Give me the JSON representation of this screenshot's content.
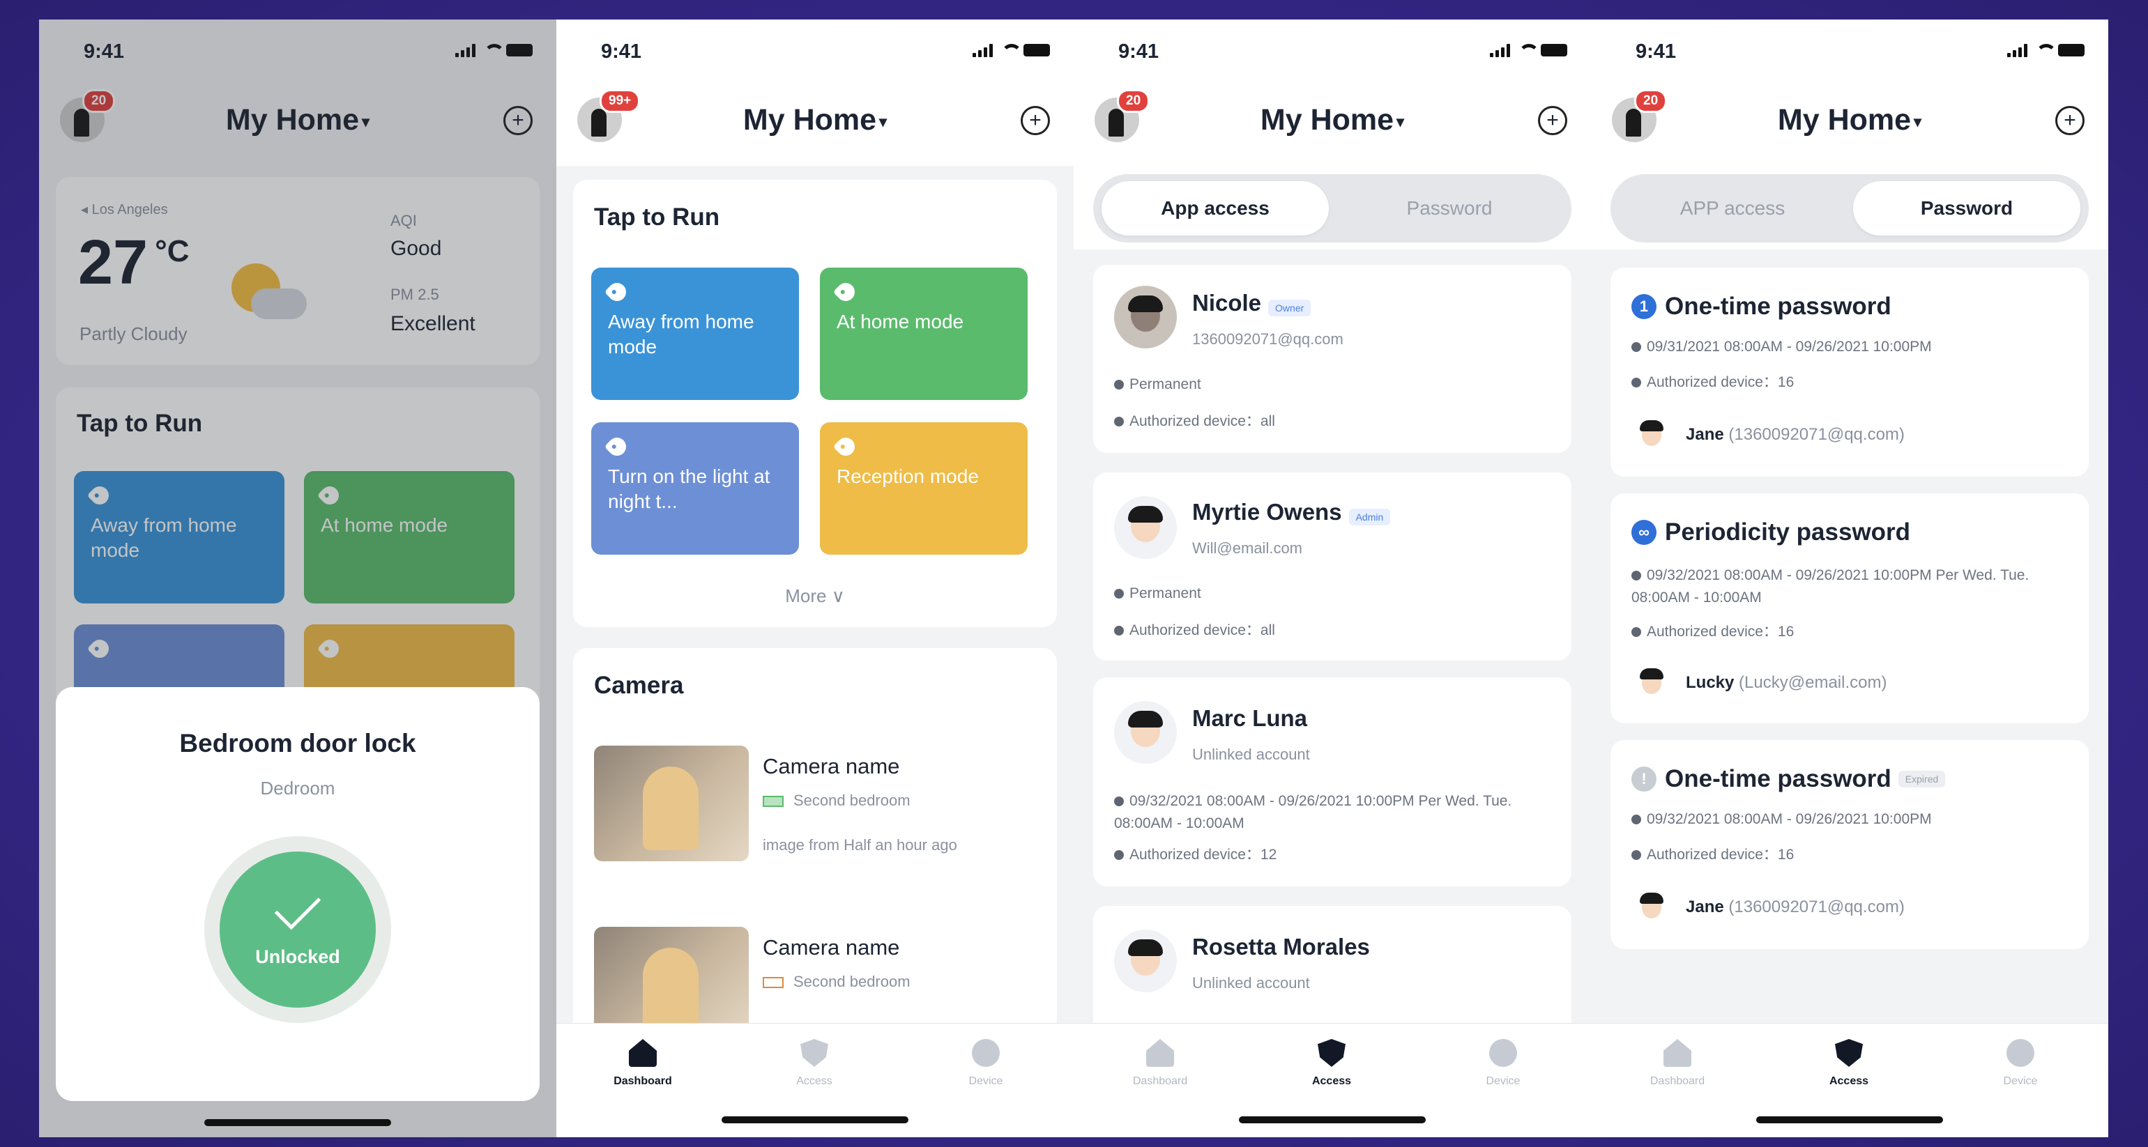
{
  "status": {
    "time": "9:41"
  },
  "screen1": {
    "badge": "20",
    "title": "My Home",
    "weather": {
      "location": "Los Angeles",
      "temp": "27",
      "unit": "°C",
      "condition": "Partly Cloudy",
      "aqi_label": "AQI",
      "aqi_value": "Good",
      "pm_label": "PM 2.5",
      "pm_value": "Excellent"
    },
    "tap_to_run": "Tap to Run",
    "tiles": [
      "Away from home mode",
      "At home mode"
    ],
    "sheet": {
      "title": "Bedroom door lock",
      "room": "Dedroom",
      "state": "Unlocked"
    }
  },
  "screen2": {
    "badge": "99+",
    "title": "My Home",
    "tap_to_run": "Tap to Run",
    "tiles": [
      "Away from home mode",
      "At home mode",
      "Turn on the light at night t...",
      "Reception mode"
    ],
    "more": "More",
    "camera_title": "Camera",
    "cameras": [
      {
        "name": "Camera name",
        "room": "Second bedroom",
        "note": "image from Half an hour ago"
      },
      {
        "name": "Camera name",
        "room": "Second bedroom"
      }
    ]
  },
  "screen3": {
    "badge": "20",
    "title": "My Home",
    "tabs": [
      "App access",
      "Password"
    ],
    "people": [
      {
        "name": "Nicole",
        "role": "Owner",
        "sub": "1360092071@qq.com",
        "lines": [
          "Permanent",
          "Authorized device：all"
        ]
      },
      {
        "name": "Myrtie Owens",
        "role": "Admin",
        "sub": "Will@email.com",
        "lines": [
          "Permanent",
          "Authorized device：all"
        ]
      },
      {
        "name": "Marc Luna",
        "sub": "Unlinked account",
        "lines": [
          "09/32/2021 08:00AM - 09/26/2021 10:00PM  Per Wed. Tue. 08:00AM - 10:00AM",
          "Authorized device：12"
        ]
      },
      {
        "name": "Rosetta Morales",
        "sub": "Unlinked account"
      }
    ]
  },
  "screen4": {
    "badge": "20",
    "title": "My Home",
    "tabs": [
      "APP access",
      "Password"
    ],
    "passwords": [
      {
        "title": "One-time password",
        "time": "09/31/2021 08:00AM - 09/26/2021 10:00PM",
        "device": "Authorized device：16",
        "user": "Jane",
        "email": "(1360092071@qq.com)"
      },
      {
        "title": "Periodicity password",
        "time": "09/32/2021 08:00AM - 09/26/2021 10:00PM  Per Wed. Tue. 08:00AM - 10:00AM",
        "device": "Authorized device：16",
        "user": "Lucky",
        "email": "(Lucky@email.com)"
      },
      {
        "title": "One-time password",
        "tag": "Expired",
        "time": "09/32/2021 08:00AM - 09/26/2021 10:00PM",
        "device": "Authorized device：16",
        "user": "Jane",
        "email": "(1360092071@qq.com)"
      }
    ]
  },
  "nav": [
    "Dashboard",
    "Access",
    "Device"
  ],
  "colors": {
    "background": "#3a2f8e",
    "tile_blue": "#3a93d7",
    "tile_green": "#5bbb6d",
    "tile_indigo": "#6d8fd6",
    "tile_yellow": "#efbc48",
    "unlocked": "#5dbd86",
    "badge": "#e0413d"
  },
  "icons": [
    "chevron-down-icon",
    "add-circle-icon",
    "tag-icon",
    "check-icon",
    "dashboard-home-icon",
    "access-shield-icon",
    "device-icon",
    "info-icon",
    "periodic-icon",
    "cell-signal-icon",
    "wifi-icon",
    "battery-icon"
  ]
}
